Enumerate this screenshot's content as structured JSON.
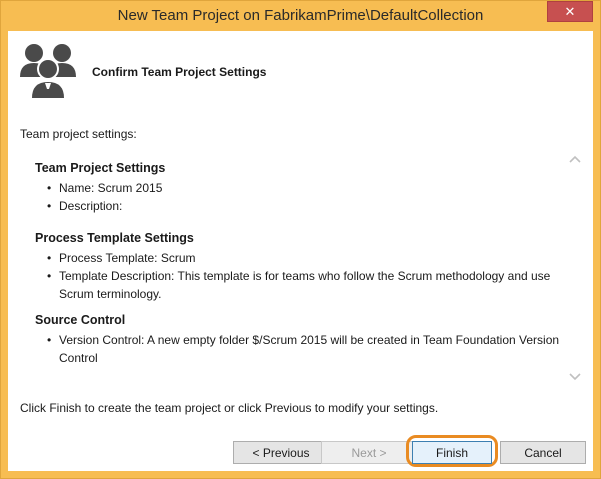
{
  "window": {
    "title": "New Team Project on FabrikamPrime\\DefaultCollection",
    "close_glyph": "✕"
  },
  "header": {
    "icon": "team-users-icon",
    "title": "Confirm Team Project Settings"
  },
  "intro": "Team project settings:",
  "sections": {
    "team_project": {
      "title": "Team Project Settings",
      "items": [
        "Name: Scrum 2015",
        "Description:"
      ]
    },
    "process_template": {
      "title": "Process Template Settings",
      "items": [
        "Process Template: Scrum",
        "Template Description: This template is for teams who follow the Scrum methodology and use Scrum terminology."
      ]
    },
    "source_control": {
      "title": "Source Control",
      "items": [
        "Version Control: A new empty folder $/Scrum 2015 will be created in Team Foundation Version Control"
      ]
    }
  },
  "scroll": {
    "up_icon": "chevron-up-icon",
    "down_icon": "chevron-down-icon"
  },
  "footer": {
    "instruction": "Click Finish to create the team project or click Previous to modify your settings."
  },
  "buttons": {
    "previous": "< Previous",
    "next": "Next >",
    "finish": "Finish",
    "cancel": "Cancel"
  },
  "colors": {
    "window_frame": "#f7bd52",
    "close_button": "#c75050",
    "highlight_ring": "#e98b22"
  }
}
